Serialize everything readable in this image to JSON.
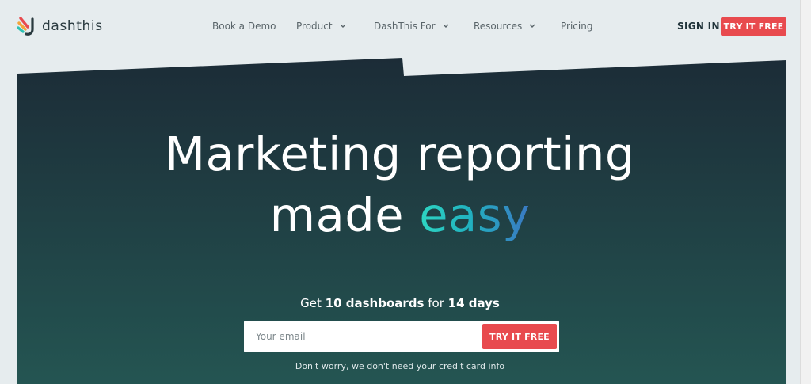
{
  "header": {
    "logo_text": "dashthis",
    "nav": [
      {
        "label": "Book a Demo",
        "has_dropdown": false
      },
      {
        "label": "Product",
        "has_dropdown": true
      },
      {
        "label": "DashThis For",
        "has_dropdown": true
      },
      {
        "label": "Resources",
        "has_dropdown": true
      },
      {
        "label": "Pricing",
        "has_dropdown": false
      }
    ],
    "signin_label": "SIGN IN",
    "try_label": "TRY IT FREE"
  },
  "hero": {
    "headline_line1": "Marketing reporting",
    "headline_line2_prefix": "made ",
    "headline_highlight": "easy",
    "offer_prefix": "Get ",
    "offer_count": "10 dashboards",
    "offer_mid": " for ",
    "offer_days": "14 days",
    "email_placeholder": "Your email",
    "try_label": "TRY IT FREE",
    "note": "Don't worry, we don't need your credit card info"
  },
  "colors": {
    "accent": "#e84a4e",
    "hero_top": "#1c2d38",
    "hero_bottom": "#235350",
    "page_bg": "#e6ecee",
    "easy_gradient": [
      "#2ed6c2",
      "#3a78c2"
    ]
  },
  "icons": {
    "logo": "dashthis-logo-icon",
    "dropdown": "chevron-down-icon"
  }
}
